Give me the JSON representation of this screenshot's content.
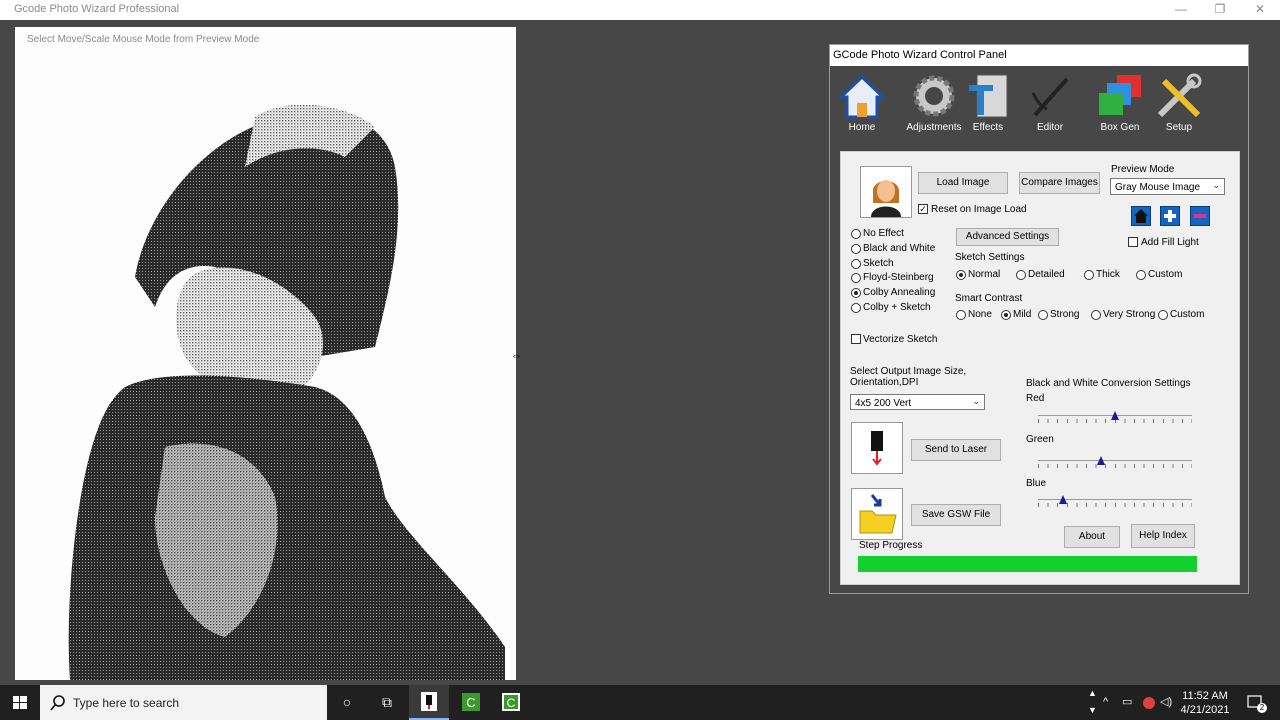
{
  "window": {
    "title": "Gcode Photo Wizard Professional",
    "minimize": "—",
    "restore": "❐",
    "close": "✕"
  },
  "preview": {
    "hint": "Select Move/Scale Mouse Mode from Preview Mode",
    "image_icon": "sketch-photo-girl"
  },
  "panel": {
    "title": "GCode Photo Wizard Control Panel",
    "toolbar": [
      {
        "label": "Home",
        "icon": "house-icon"
      },
      {
        "label": "Adjustments",
        "icon": "gear-icon"
      },
      {
        "label": "Effects",
        "icon": "effects-icon"
      },
      {
        "label": "Editor",
        "icon": "pen-icon"
      },
      {
        "label": "Box Gen",
        "icon": "box-icon"
      },
      {
        "label": "Setup",
        "icon": "tools-icon"
      }
    ],
    "load_image": "Load Image",
    "compare_images": "Compare Images",
    "reset_on_load": "Reset on Image Load",
    "reset_checked": true,
    "preview_mode_label": "Preview Mode",
    "preview_mode_value": "Gray Mouse Image",
    "add_fill_light": "Add Fill Light",
    "effects": [
      {
        "label": "No Effect",
        "selected": false
      },
      {
        "label": "Black and White",
        "selected": false
      },
      {
        "label": "Sketch",
        "selected": false
      },
      {
        "label": "Floyd-Steinberg",
        "selected": false
      },
      {
        "label": "Colby Annealing",
        "selected": true
      },
      {
        "label": "Colby + Sketch",
        "selected": false
      }
    ],
    "advanced_settings": "Advanced Settings",
    "sketch_settings_label": "Sketch Settings",
    "sketch_settings": [
      {
        "label": "Normal",
        "selected": true
      },
      {
        "label": "Detailed",
        "selected": false
      },
      {
        "label": "Thick",
        "selected": false
      },
      {
        "label": "Custom",
        "selected": false
      }
    ],
    "smart_contrast_label": "Smart Contrast",
    "smart_contrast": [
      {
        "label": "None",
        "selected": false
      },
      {
        "label": "Mild",
        "selected": true
      },
      {
        "label": "Strong",
        "selected": false
      },
      {
        "label": "Very Strong",
        "selected": false
      },
      {
        "label": "Custom",
        "selected": false
      }
    ],
    "vectorize_sketch": "Vectorize Sketch",
    "output_size_label": "Select Output Image Size, Orientation,DPI",
    "output_size_value": "4x5 200 Vert",
    "send_to_laser": "Send to Laser",
    "save_gsw": "Save GSW File",
    "bw_conversion_label": "Black and White Conversion Settings",
    "sliders": [
      {
        "label": "Red",
        "value": 0.5
      },
      {
        "label": "Green",
        "value": 0.41
      },
      {
        "label": "Blue",
        "value": 0.16
      }
    ],
    "about": "About",
    "help_index": "Help Index",
    "step_progress_label": "Step Progress",
    "progress": 1.0,
    "progress_color": "#13d02f"
  },
  "taskbar": {
    "search_placeholder": "Type here to search",
    "time": "11:52 AM",
    "date": "4/21/2021",
    "notification_count": "2"
  }
}
